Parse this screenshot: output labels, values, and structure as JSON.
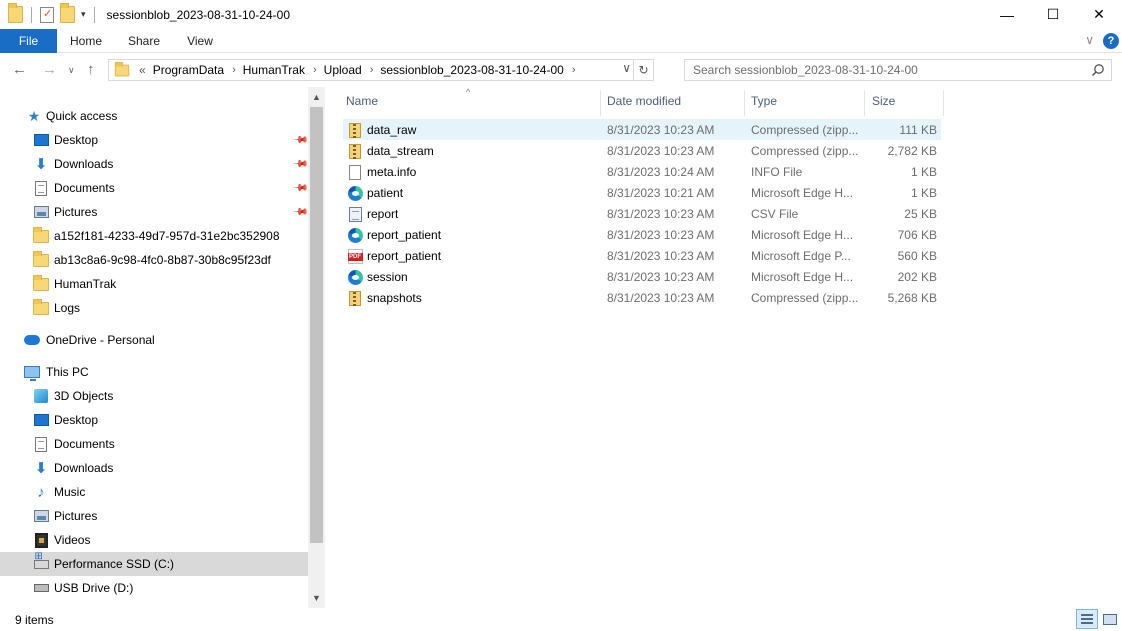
{
  "window": {
    "title": "sessionblob_2023-08-31-10-24-00",
    "minimize_glyph": "—",
    "maximize_glyph": "☐",
    "close_glyph": "✕"
  },
  "ribbon": {
    "tabs": [
      {
        "label": "File"
      },
      {
        "label": "Home"
      },
      {
        "label": "Share"
      },
      {
        "label": "View"
      }
    ],
    "help_glyph": "?",
    "expand_glyph": "∨"
  },
  "address_bar": {
    "overflow": "«",
    "breadcrumbs": [
      "ProgramData",
      "HumanTrak",
      "Upload",
      "sessionblob_2023-08-31-10-24-00"
    ]
  },
  "search": {
    "placeholder": "Search sessionblob_2023-08-31-10-24-00"
  },
  "nav_pane": {
    "items": [
      {
        "label": "Quick access",
        "icon": "star-icon"
      },
      {
        "label": "Desktop",
        "icon": "desktop-icon",
        "pinned": true
      },
      {
        "label": "Downloads",
        "icon": "download-icon",
        "pinned": true
      },
      {
        "label": "Documents",
        "icon": "documents-icon",
        "pinned": true
      },
      {
        "label": "Pictures",
        "icon": "pictures-icon",
        "pinned": true
      },
      {
        "label": "a152f181-4233-49d7-957d-31e2bc352908",
        "icon": "folder-icon"
      },
      {
        "label": "ab13c8a6-9c98-4fc0-8b87-30b8c95f23df",
        "icon": "folder-icon"
      },
      {
        "label": "HumanTrak",
        "icon": "folder-icon"
      },
      {
        "label": "Logs",
        "icon": "folder-icon"
      },
      {
        "label": "OneDrive - Personal",
        "icon": "onedrive-icon"
      },
      {
        "label": "This PC",
        "icon": "this-pc-icon"
      },
      {
        "label": "3D Objects",
        "icon": "3d-objects-icon"
      },
      {
        "label": "Desktop",
        "icon": "desktop-icon"
      },
      {
        "label": "Documents",
        "icon": "documents-icon"
      },
      {
        "label": "Downloads",
        "icon": "download-icon"
      },
      {
        "label": "Music",
        "icon": "music-icon"
      },
      {
        "label": "Pictures",
        "icon": "pictures-icon"
      },
      {
        "label": "Videos",
        "icon": "videos-icon"
      },
      {
        "label": "Performance SSD (C:)",
        "icon": "drive-icon",
        "selected": true
      },
      {
        "label": "USB Drive (D:)",
        "icon": "usb-drive-icon"
      }
    ]
  },
  "file_list": {
    "columns": {
      "name": "Name",
      "date": "Date modified",
      "type": "Type",
      "size": "Size"
    },
    "files": [
      {
        "name": "data_raw",
        "date": "8/31/2023 10:23 AM",
        "type": "Compressed (zipp...",
        "size": "111 KB",
        "icon": "zip-icon",
        "selected": true
      },
      {
        "name": "data_stream",
        "date": "8/31/2023 10:23 AM",
        "type": "Compressed (zipp...",
        "size": "2,782 KB",
        "icon": "zip-icon"
      },
      {
        "name": "meta.info",
        "date": "8/31/2023 10:24 AM",
        "type": "INFO File",
        "size": "1 KB",
        "icon": "file-icon"
      },
      {
        "name": "patient",
        "date": "8/31/2023 10:21 AM",
        "type": "Microsoft Edge H...",
        "size": "1 KB",
        "icon": "edge-icon"
      },
      {
        "name": "report",
        "date": "8/31/2023 10:23 AM",
        "type": "CSV File",
        "size": "25 KB",
        "icon": "csv-icon"
      },
      {
        "name": "report_patient",
        "date": "8/31/2023 10:23 AM",
        "type": "Microsoft Edge H...",
        "size": "706 KB",
        "icon": "edge-icon"
      },
      {
        "name": "report_patient",
        "date": "8/31/2023 10:23 AM",
        "type": "Microsoft Edge P...",
        "size": "560 KB",
        "icon": "pdf-icon"
      },
      {
        "name": "session",
        "date": "8/31/2023 10:23 AM",
        "type": "Microsoft Edge H...",
        "size": "202 KB",
        "icon": "edge-icon"
      },
      {
        "name": "snapshots",
        "date": "8/31/2023 10:23 AM",
        "type": "Compressed (zipp...",
        "size": "5,268 KB",
        "icon": "zip-icon"
      }
    ]
  },
  "status_bar": {
    "item_count": "9 items"
  }
}
